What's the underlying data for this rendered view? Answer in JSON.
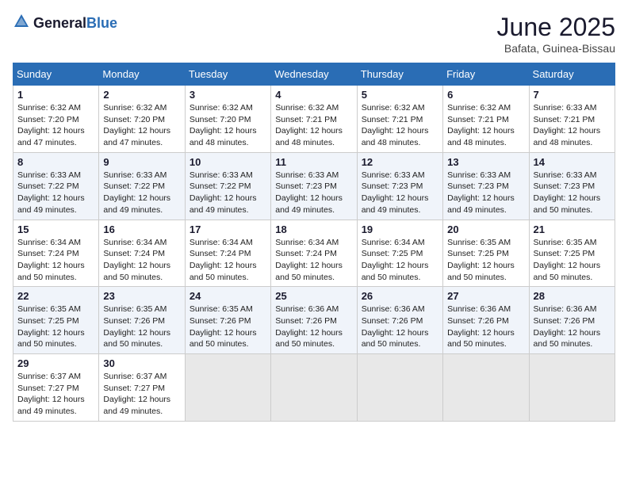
{
  "header": {
    "logo_general": "General",
    "logo_blue": "Blue",
    "month": "June 2025",
    "location": "Bafata, Guinea-Bissau"
  },
  "columns": [
    "Sunday",
    "Monday",
    "Tuesday",
    "Wednesday",
    "Thursday",
    "Friday",
    "Saturday"
  ],
  "weeks": [
    [
      {
        "day": 1,
        "sunrise": "6:32 AM",
        "sunset": "7:20 PM",
        "daylight": "12 hours and 47 minutes."
      },
      {
        "day": 2,
        "sunrise": "6:32 AM",
        "sunset": "7:20 PM",
        "daylight": "12 hours and 47 minutes."
      },
      {
        "day": 3,
        "sunrise": "6:32 AM",
        "sunset": "7:20 PM",
        "daylight": "12 hours and 48 minutes."
      },
      {
        "day": 4,
        "sunrise": "6:32 AM",
        "sunset": "7:21 PM",
        "daylight": "12 hours and 48 minutes."
      },
      {
        "day": 5,
        "sunrise": "6:32 AM",
        "sunset": "7:21 PM",
        "daylight": "12 hours and 48 minutes."
      },
      {
        "day": 6,
        "sunrise": "6:32 AM",
        "sunset": "7:21 PM",
        "daylight": "12 hours and 48 minutes."
      },
      {
        "day": 7,
        "sunrise": "6:33 AM",
        "sunset": "7:21 PM",
        "daylight": "12 hours and 48 minutes."
      }
    ],
    [
      {
        "day": 8,
        "sunrise": "6:33 AM",
        "sunset": "7:22 PM",
        "daylight": "12 hours and 49 minutes."
      },
      {
        "day": 9,
        "sunrise": "6:33 AM",
        "sunset": "7:22 PM",
        "daylight": "12 hours and 49 minutes."
      },
      {
        "day": 10,
        "sunrise": "6:33 AM",
        "sunset": "7:22 PM",
        "daylight": "12 hours and 49 minutes."
      },
      {
        "day": 11,
        "sunrise": "6:33 AM",
        "sunset": "7:23 PM",
        "daylight": "12 hours and 49 minutes."
      },
      {
        "day": 12,
        "sunrise": "6:33 AM",
        "sunset": "7:23 PM",
        "daylight": "12 hours and 49 minutes."
      },
      {
        "day": 13,
        "sunrise": "6:33 AM",
        "sunset": "7:23 PM",
        "daylight": "12 hours and 49 minutes."
      },
      {
        "day": 14,
        "sunrise": "6:33 AM",
        "sunset": "7:23 PM",
        "daylight": "12 hours and 50 minutes."
      }
    ],
    [
      {
        "day": 15,
        "sunrise": "6:34 AM",
        "sunset": "7:24 PM",
        "daylight": "12 hours and 50 minutes."
      },
      {
        "day": 16,
        "sunrise": "6:34 AM",
        "sunset": "7:24 PM",
        "daylight": "12 hours and 50 minutes."
      },
      {
        "day": 17,
        "sunrise": "6:34 AM",
        "sunset": "7:24 PM",
        "daylight": "12 hours and 50 minutes."
      },
      {
        "day": 18,
        "sunrise": "6:34 AM",
        "sunset": "7:24 PM",
        "daylight": "12 hours and 50 minutes."
      },
      {
        "day": 19,
        "sunrise": "6:34 AM",
        "sunset": "7:25 PM",
        "daylight": "12 hours and 50 minutes."
      },
      {
        "day": 20,
        "sunrise": "6:35 AM",
        "sunset": "7:25 PM",
        "daylight": "12 hours and 50 minutes."
      },
      {
        "day": 21,
        "sunrise": "6:35 AM",
        "sunset": "7:25 PM",
        "daylight": "12 hours and 50 minutes."
      }
    ],
    [
      {
        "day": 22,
        "sunrise": "6:35 AM",
        "sunset": "7:25 PM",
        "daylight": "12 hours and 50 minutes."
      },
      {
        "day": 23,
        "sunrise": "6:35 AM",
        "sunset": "7:26 PM",
        "daylight": "12 hours and 50 minutes."
      },
      {
        "day": 24,
        "sunrise": "6:35 AM",
        "sunset": "7:26 PM",
        "daylight": "12 hours and 50 minutes."
      },
      {
        "day": 25,
        "sunrise": "6:36 AM",
        "sunset": "7:26 PM",
        "daylight": "12 hours and 50 minutes."
      },
      {
        "day": 26,
        "sunrise": "6:36 AM",
        "sunset": "7:26 PM",
        "daylight": "12 hours and 50 minutes."
      },
      {
        "day": 27,
        "sunrise": "6:36 AM",
        "sunset": "7:26 PM",
        "daylight": "12 hours and 50 minutes."
      },
      {
        "day": 28,
        "sunrise": "6:36 AM",
        "sunset": "7:26 PM",
        "daylight": "12 hours and 50 minutes."
      }
    ],
    [
      {
        "day": 29,
        "sunrise": "6:37 AM",
        "sunset": "7:27 PM",
        "daylight": "12 hours and 49 minutes."
      },
      {
        "day": 30,
        "sunrise": "6:37 AM",
        "sunset": "7:27 PM",
        "daylight": "12 hours and 49 minutes."
      },
      null,
      null,
      null,
      null,
      null
    ]
  ]
}
